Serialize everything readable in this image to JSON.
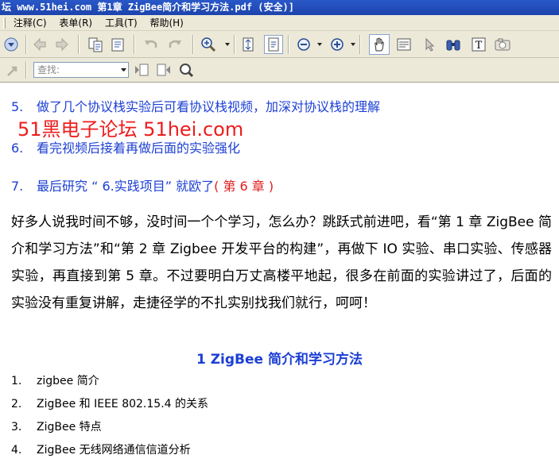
{
  "window": {
    "title": "坛 www.51hei.com 第1章 ZigBee简介和学习方法.pdf (安全)]"
  },
  "menubar": {
    "items": [
      "注释(C)",
      "表单(R)",
      "工具(T)",
      "帮助(H)"
    ]
  },
  "search": {
    "placeholder": "查找:"
  },
  "colors": {
    "accent_blue": "#1c3fd4",
    "accent_red": "#e01c1c",
    "chrome": "#ece9d8"
  },
  "document": {
    "steps": [
      {
        "num": "5.",
        "text": "做了几个协议栈实验后可看协议栈视频，加深对协议栈的理解"
      },
      {
        "num": "6.",
        "text": "看完视频后接着再做后面的实验强化"
      },
      {
        "num": "7.",
        "text": "最后研究 “ 6.实践项目” 就欧了",
        "suffix": "( 第 6 章 )"
      }
    ],
    "watermark": "51黑电子论坛 51hei.com",
    "paragraph": "好多人说我时间不够，没时间一个个学习，怎么办？跳跃式前进吧，看“第 1 章 ZigBee 简介和学习方法”和“第 2 章 Zigbee 开发平台的构建”，再做下 IO 实验、串口实验、传感器实验，再直接到第 5 章。不过要明白万丈高楼平地起，很多在前面的实验讲过了，后面的实验没有重复讲解，走捷径学的不扎实别找我们就行，呵呵！",
    "section_heading": "1  ZigBee 简介和学习方法",
    "toc": [
      {
        "num": "1.",
        "text": "zigbee 简介"
      },
      {
        "num": "2.",
        "text": "ZigBee 和 IEEE 802.15.4 的关系"
      },
      {
        "num": "3.",
        "text": "ZigBee 特点"
      },
      {
        "num": "4.",
        "text": "ZigBee  无线网络通信信道分析"
      }
    ]
  }
}
